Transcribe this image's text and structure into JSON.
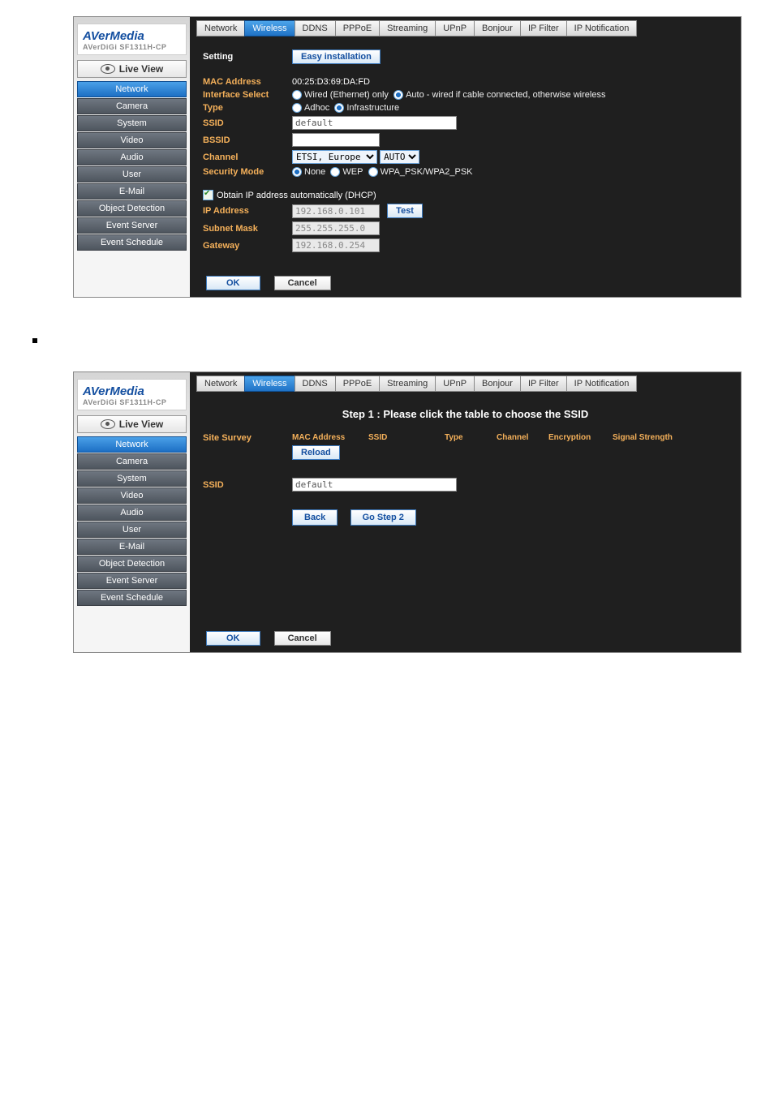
{
  "logo": {
    "title": "AVerMedia",
    "sub": "AVerDiGi SF1311H-CP"
  },
  "live_view": "Live View",
  "sidebar": [
    {
      "label": "Network",
      "active": true
    },
    {
      "label": "Camera"
    },
    {
      "label": "System"
    },
    {
      "label": "Video"
    },
    {
      "label": "Audio"
    },
    {
      "label": "User"
    },
    {
      "label": "E-Mail"
    },
    {
      "label": "Object Detection"
    },
    {
      "label": "Event Server"
    },
    {
      "label": "Event Schedule"
    }
  ],
  "tabs": [
    "Network",
    "Wireless",
    "DDNS",
    "PPPoE",
    "Streaming",
    "UPnP",
    "Bonjour",
    "IP Filter",
    "IP Notification"
  ],
  "screen1": {
    "setting_label": "Setting",
    "easy_install_btn": "Easy installation",
    "mac_label": "MAC Address",
    "mac_value": "00:25:D3:69:DA:FD",
    "iface_label": "Interface Select",
    "iface_opt1": "Wired (Ethernet) only",
    "iface_opt2": "Auto - wired if cable connected, otherwise wireless",
    "type_label": "Type",
    "type_opt1": "Adhoc",
    "type_opt2": "Infrastructure",
    "ssid_label": "SSID",
    "ssid_value": "default",
    "bssid_label": "BSSID",
    "bssid_value": "",
    "chan_label": "Channel",
    "chan_sel1": "ETSI, Europe",
    "chan_sel2": "AUTO",
    "sec_label": "Security Mode",
    "sec_opt1": "None",
    "sec_opt2": "WEP",
    "sec_opt3": "WPA_PSK/WPA2_PSK",
    "dhcp_label": "Obtain IP address automatically (DHCP)",
    "ip_label": "IP Address",
    "ip_value": "192.168.0.101",
    "test_btn": "Test",
    "subnet_label": "Subnet Mask",
    "subnet_value": "255.255.255.0",
    "gw_label": "Gateway",
    "gw_value": "192.168.0.254",
    "ok": "OK",
    "cancel": "Cancel"
  },
  "screen2": {
    "step_title": "Step 1 : Please click the table to choose the SSID",
    "survey_label": "Site Survey",
    "th_mac": "MAC Address",
    "th_ssid": "SSID",
    "th_type": "Type",
    "th_chan": "Channel",
    "th_enc": "Encryption",
    "th_sig": "Signal Strength",
    "reload_btn": "Reload",
    "ssid_label": "SSID",
    "ssid_value": "default",
    "back_btn": "Back",
    "step2_btn": "Go Step 2",
    "ok": "OK",
    "cancel": "Cancel"
  }
}
